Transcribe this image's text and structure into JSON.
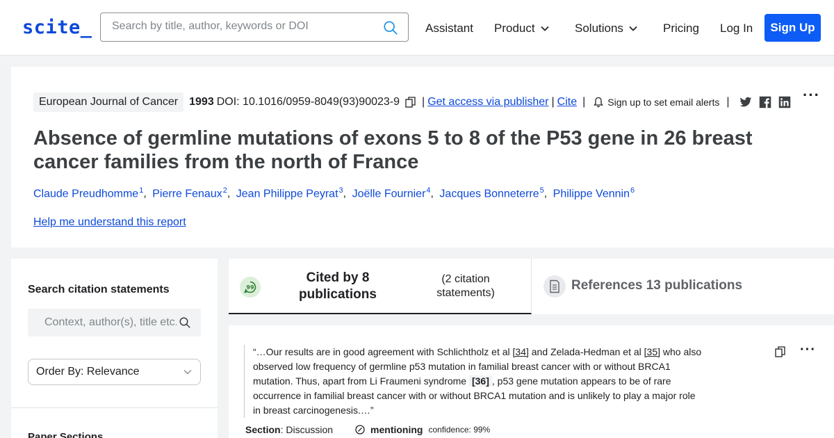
{
  "header": {
    "logo": "scite_",
    "search_placeholder": "Search by title, author, keywords or DOI",
    "nav": {
      "assistant": "Assistant",
      "product": "Product",
      "solutions": "Solutions",
      "pricing": "Pricing",
      "login": "Log In",
      "signup": "Sign Up"
    }
  },
  "paper": {
    "journal": "European Journal of Cancer",
    "year": "1993",
    "doi": "DOI: 10.1016/0959-8049(93)90023-9",
    "get_access": "Get access via publisher",
    "cite": "Cite",
    "alerts": "Sign up to set email alerts",
    "title": "Absence of germline mutations of exons 5 to 8 of the P53 gene in 26 breast cancer families from the north of France",
    "authors": [
      {
        "name": "Claude Preudhomme",
        "sup": "1"
      },
      {
        "name": "Pierre Fenaux",
        "sup": "2"
      },
      {
        "name": "Jean Philippe Peyrat",
        "sup": "3"
      },
      {
        "name": "Joëlle Fournier",
        "sup": "4"
      },
      {
        "name": "Jacques Bonneterre",
        "sup": "5"
      },
      {
        "name": "Philippe Vennin",
        "sup": "6"
      }
    ],
    "help": "Help me understand this report"
  },
  "sidebar": {
    "search_title": "Search citation statements",
    "search_placeholder": "Context, author(s), title etc.",
    "order_by": "Order By: Relevance",
    "paper_sections": "Paper Sections"
  },
  "tabs": {
    "cited_main": "Cited by 8 publications",
    "cited_sub": "(2 citation statements)",
    "references": "References 13 publications"
  },
  "citation": {
    "q1": "“…Our results are in good agreement with Schlichtholz et al ",
    "r1": "[34]",
    "q2": " and Zelada-Hedman et al ",
    "r2": "[35]",
    "q3": " who also observed low frequency of germline p53 mutation in familial breast cancer with or without BRCA1 mutation. Thus, apart from Li Fraumeni syndrome ",
    "r3": "[36]",
    "q4": ", p53 gene mutation appears to be of rare occurrence in familial breast cancer with or without BRCA1 mutation and is unlikely to play a major role in breast carcinogenesis.…”",
    "section_label": "Section",
    "section_value": ": Discussion",
    "type": "mentioning",
    "confidence": "confidence: 99%"
  }
}
